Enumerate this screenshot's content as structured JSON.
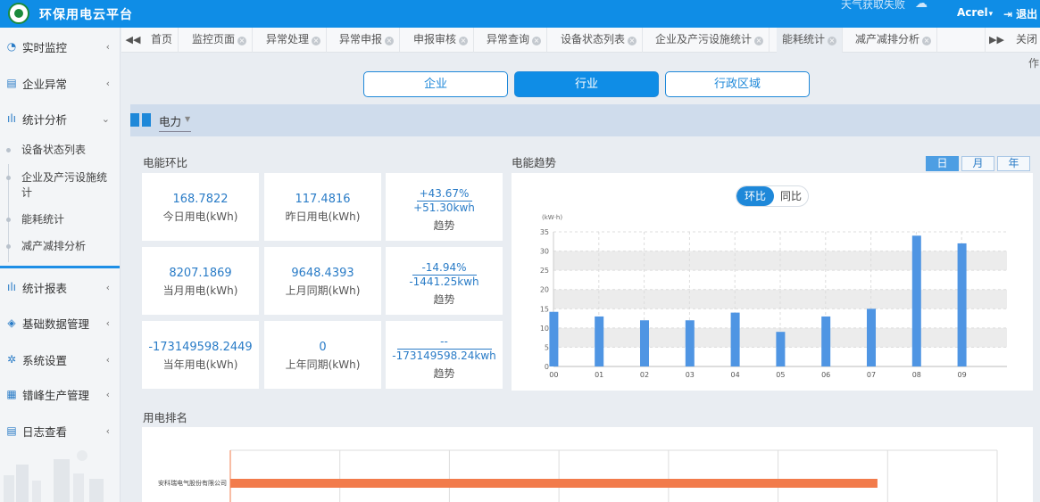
{
  "app": {
    "title": "环保用电云平台",
    "weather": "天气获取失败",
    "user": "Acrel",
    "user_caret": "▾",
    "logout": "退出"
  },
  "sidebar": {
    "items": [
      {
        "label": "实时监控",
        "icon": "monitor-icon"
      },
      {
        "label": "企业异常",
        "icon": "document-icon"
      },
      {
        "label": "统计分析",
        "icon": "bar-chart-icon"
      },
      {
        "label": "统计报表",
        "icon": "bar-chart-icon"
      },
      {
        "label": "基础数据管理",
        "icon": "layers-icon"
      },
      {
        "label": "系统设置",
        "icon": "gear-icon"
      },
      {
        "label": "错峰生产管理",
        "icon": "calendar-icon"
      },
      {
        "label": "日志查看",
        "icon": "document-icon"
      }
    ],
    "subitems": [
      "设备状态列表",
      "企业及产污设施统计",
      "能耗统计",
      "减产减排分析"
    ]
  },
  "tabs": {
    "items": [
      "首页",
      "监控页面",
      "异常处理",
      "异常申报",
      "申报审核",
      "异常查询",
      "设备状态列表",
      "企业及产污设施统计",
      "能耗统计",
      "减产减排分析"
    ],
    "active": "能耗统计",
    "close_all": "关闭",
    "sub_op": "作"
  },
  "scope_buttons": [
    {
      "label": "企业",
      "active": false
    },
    {
      "label": "行业",
      "active": true
    },
    {
      "label": "行政区域",
      "active": false
    }
  ],
  "energy_type": "电力",
  "ratio_section": {
    "title": "电能环比",
    "rows": [
      {
        "current": {
          "value": "168.7822",
          "label": "今日用电(kWh)"
        },
        "previous": {
          "value": "117.4816",
          "label": "昨日用电(kWh)"
        },
        "trend": {
          "percent": "+43.67%",
          "diff": "+51.30kwh",
          "label": "趋势"
        }
      },
      {
        "current": {
          "value": "8207.1869",
          "label": "当月用电(kWh)"
        },
        "previous": {
          "value": "9648.4393",
          "label": "上月同期(kWh)"
        },
        "trend": {
          "percent": "-14.94%",
          "diff": "-1441.25kwh",
          "label": "趋势"
        }
      },
      {
        "current": {
          "value": "-173149598.2449",
          "label": "当年用电(kWh)"
        },
        "previous": {
          "value": "0",
          "label": "上年同期(kWh)"
        },
        "trend": {
          "percent": "--",
          "diff": "-173149598.24kwh",
          "label": "趋势"
        }
      }
    ]
  },
  "trend_section": {
    "title": "电能趋势",
    "periods": [
      {
        "label": "日",
        "active": true
      },
      {
        "label": "月",
        "active": false
      },
      {
        "label": "年",
        "active": false
      }
    ],
    "compare": [
      {
        "label": "环比",
        "active": true
      },
      {
        "label": "同比",
        "active": false
      }
    ]
  },
  "ranking_section": {
    "title": "用电排名"
  },
  "colors": {
    "header": "#0f8de6",
    "accent": "#1e88d9",
    "bar": "#4f95e3",
    "rank_bar": "#f27b4b"
  },
  "chart_data": [
    {
      "type": "bar",
      "ylabel": "(kW·h)",
      "categories": [
        "00",
        "01",
        "02",
        "03",
        "04",
        "05",
        "06",
        "07",
        "08",
        "09"
      ],
      "values": [
        14.2,
        13.0,
        12.0,
        12.0,
        14.0,
        9.0,
        13.0,
        15.0,
        34.0,
        32.0
      ],
      "ylim": [
        0,
        35
      ],
      "yticks": [
        0,
        5,
        10,
        15,
        20,
        25,
        30,
        35
      ],
      "grid": true
    },
    {
      "type": "bar",
      "orientation": "horizontal",
      "categories": [
        "安科瑞电气股份有限公司"
      ],
      "values": [
        168.7822
      ],
      "xlim": [
        0,
        200
      ],
      "grid": true
    }
  ]
}
